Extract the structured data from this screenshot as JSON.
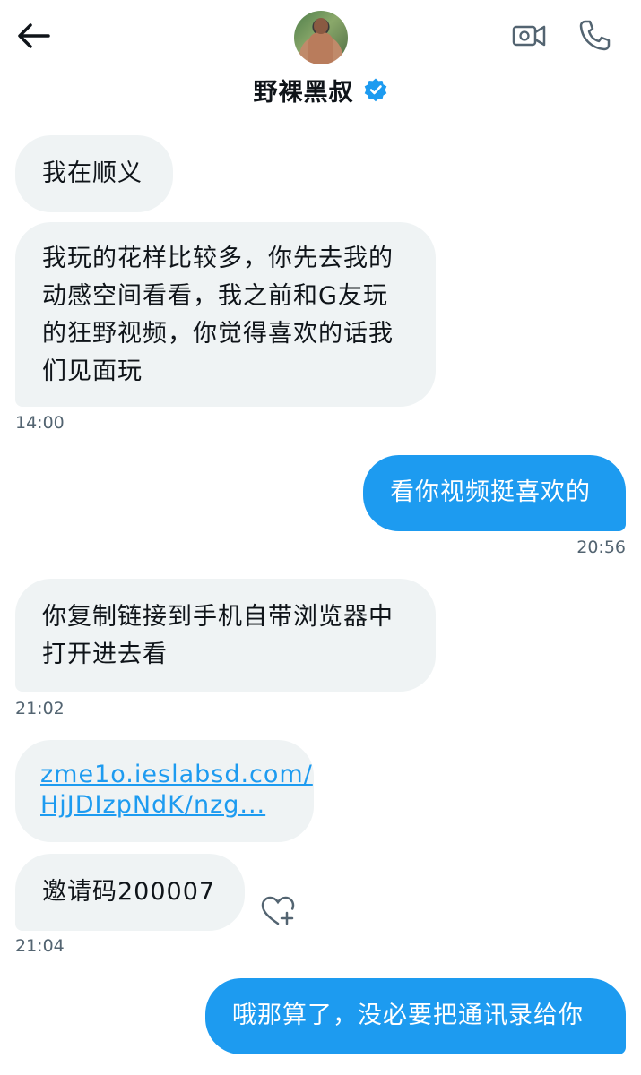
{
  "header": {
    "title": "野裸黑叔",
    "back_icon": "arrow-left-icon",
    "verified_icon": "verified-badge-icon",
    "video_icon": "video-call-icon",
    "phone_icon": "phone-icon",
    "accent_color": "#1d9bf0"
  },
  "messages": [
    {
      "direction": "in",
      "text": "我在顺义"
    },
    {
      "direction": "in",
      "lines": [
        "我玩的花样比较多，你先去我的",
        "动感空间看看，我之前和G友玩",
        "的狂野视频，你觉得喜欢的话我",
        "们见面玩"
      ]
    },
    {
      "direction": "time",
      "text": "14:00"
    },
    {
      "direction": "out",
      "text": "看你视频挺喜欢的"
    },
    {
      "direction": "time",
      "text": "20:56"
    },
    {
      "direction": "in",
      "lines": [
        "你复制链接到手机自带浏览器中",
        "打开进去看"
      ]
    },
    {
      "direction": "time",
      "text": "21:02"
    },
    {
      "direction": "in",
      "link_lines": [
        "zme1o.ieslabsd.com/",
        "HjJDIzpNdK/nzg..."
      ]
    },
    {
      "direction": "in",
      "text": "邀请码200007"
    },
    {
      "direction": "time",
      "text": "21:04"
    },
    {
      "direction": "out",
      "text": "哦那算了，没必要把通讯录给你"
    }
  ],
  "react_icon": "heart-plus-icon",
  "colors": {
    "incoming_bubble": "#eff3f4",
    "outgoing_bubble": "#1d9bf0",
    "timestamp": "#536471"
  }
}
